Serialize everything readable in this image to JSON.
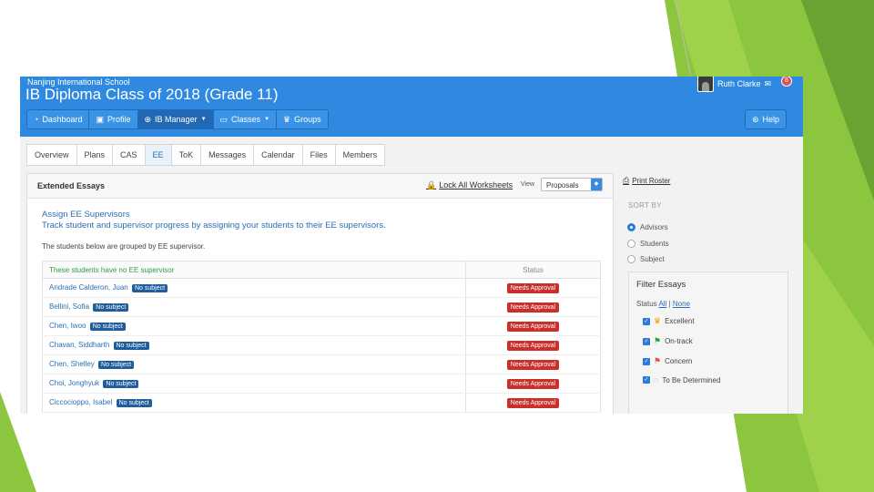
{
  "school_name": "Nanjing International School",
  "page_title": "IB Diploma Class of 2018 (Grade 11)",
  "user": {
    "name": "Ruth Clarke",
    "notifications": "8"
  },
  "topnav": [
    {
      "label": "Dashboard",
      "icon": "dashboard-icon"
    },
    {
      "label": "Profile",
      "icon": "camera-icon"
    },
    {
      "label": "IB Manager",
      "icon": "globe-icon",
      "active": true
    },
    {
      "label": "Classes",
      "icon": "classes-icon"
    },
    {
      "label": "Groups",
      "icon": "trophy-icon"
    }
  ],
  "help_label": "Help",
  "tabs": [
    {
      "label": "Overview"
    },
    {
      "label": "Plans"
    },
    {
      "label": "CAS"
    },
    {
      "label": "EE",
      "active": true
    },
    {
      "label": "ToK"
    },
    {
      "label": "Messages"
    },
    {
      "label": "Calendar"
    },
    {
      "label": "Files"
    },
    {
      "label": "Members"
    }
  ],
  "panel": {
    "title": "Extended Essays",
    "lock_link": "Lock All Worksheets",
    "view_label": "View",
    "view_value": "Proposals",
    "assign_title": "Assign EE Supervisors",
    "assign_desc": "Track student and supervisor progress by assigning your students to their EE supervisors.",
    "grouped_note": "The students below are grouped by EE supervisor.",
    "table_header": "These students have no EE supervisor",
    "status_header": "Status",
    "students": [
      {
        "name": "Andrade Calderon, Juan",
        "subject": "No subject",
        "status": "Needs Approval"
      },
      {
        "name": "Bellini, Sofia",
        "subject": "No subject",
        "status": "Needs Approval"
      },
      {
        "name": "Chen, Iwoo",
        "subject": "No subject",
        "status": "Needs Approval"
      },
      {
        "name": "Chavan, Siddharth",
        "subject": "No subject",
        "status": "Needs Approval"
      },
      {
        "name": "Chen, Shelley",
        "subject": "No subject",
        "status": "Needs Approval"
      },
      {
        "name": "Choi, Jonghyuk",
        "subject": "No subject",
        "status": "Needs Approval"
      },
      {
        "name": "Ciccocioppo, Isabel",
        "subject": "No subject",
        "status": "Needs Approval"
      }
    ]
  },
  "sidebar": {
    "print_roster": "Print Roster",
    "sort_by": "SORT BY",
    "sort_options": [
      {
        "label": "Advisors",
        "checked": true
      },
      {
        "label": "Students",
        "checked": false
      },
      {
        "label": "Subject",
        "checked": false
      }
    ],
    "filter_title": "Filter Essays",
    "status_label": "Status",
    "status_all": "All",
    "status_sep": "|",
    "status_none": "None",
    "filters": [
      {
        "label": "Excellent",
        "icon": "trophy-icon",
        "color": "#e0a800"
      },
      {
        "label": "On-track",
        "icon": "flag-icon",
        "color": "#2e9e44"
      },
      {
        "label": "Concern",
        "icon": "flag-icon",
        "color": "#d9534f"
      },
      {
        "label": "To Be Determined",
        "icon": "circle-dashed-icon",
        "color": "#3a8be0"
      }
    ]
  },
  "colors": {
    "header_blue": "#2f89e0",
    "accent_green": "#8cc63f",
    "danger": "#c9302c",
    "tag_blue": "#1f5d9c"
  }
}
